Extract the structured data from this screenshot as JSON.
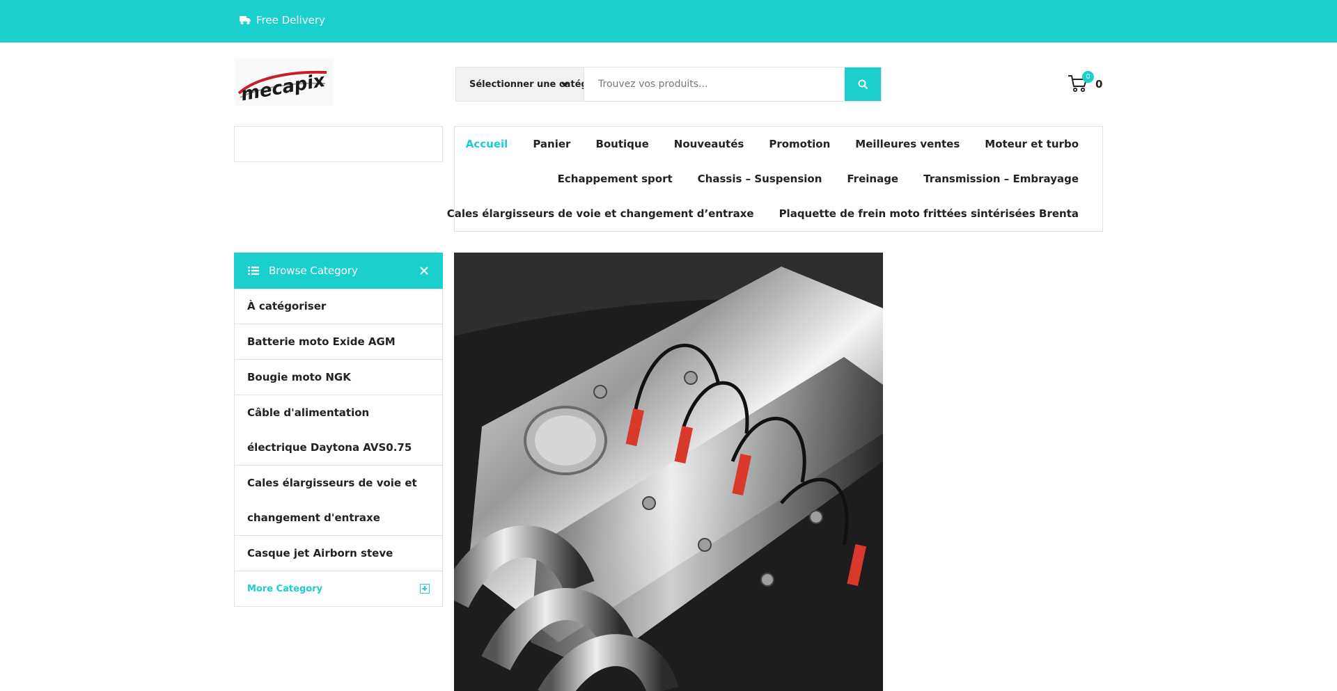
{
  "topbar": {
    "delivery_label": "Free Delivery"
  },
  "logo": {
    "text": "mecapix"
  },
  "search": {
    "category_label": "Sélectionner une catégorie",
    "placeholder": "Trouvez vos produits..."
  },
  "cart": {
    "count": "0",
    "total": "0"
  },
  "nav": {
    "row1": [
      "Accueil",
      "Panier",
      "Boutique",
      "Nouveautés",
      "Promotion",
      "Meilleures ventes",
      "Moteur et turbo"
    ],
    "row2": [
      "Echappement sport",
      "Chassis – Suspension",
      "Freinage",
      "Transmission – Embrayage"
    ],
    "row3": [
      "Cales élargisseurs de voie et changement d’entraxe",
      "Plaquette de frein moto frittées sintérisées Brenta"
    ],
    "active": "Accueil"
  },
  "categories": {
    "title": "Browse Category",
    "items": [
      "À catégoriser",
      "Batterie moto Exide AGM",
      "Bougie moto NGK",
      "Câble d'alimentation électrique Daytona AVS0.75",
      "Cales élargisseurs de voie et changement d'entraxe",
      "Casque jet Airborn steve"
    ],
    "more_label": "More Category"
  },
  "colors": {
    "accent": "#1ccfcf",
    "text": "#222222",
    "border": "#e2e2e2"
  },
  "icons": [
    "truck-icon",
    "search-icon",
    "cart-icon",
    "list-icon",
    "close-icon",
    "plus-square-icon"
  ]
}
